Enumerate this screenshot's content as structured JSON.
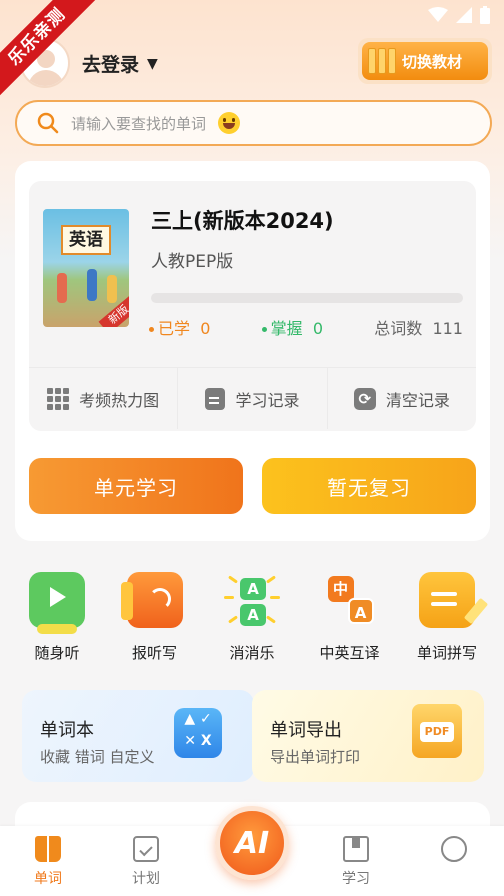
{
  "banner": {
    "ribbon_text": "乐乐亲测"
  },
  "header": {
    "login_label": "去登录",
    "switch_label": "切换教材"
  },
  "search": {
    "placeholder": "请输入要查找的单词"
  },
  "book": {
    "cover_title": "英语",
    "cover_badge": "新版",
    "title": "三上(新版本2024)",
    "publisher": "人教PEP版",
    "progress_fraction": 0,
    "learned_label": "已学",
    "learned_count": "0",
    "mastered_label": "掌握",
    "mastered_count": "0",
    "total_label": "总词数",
    "total_count": "111"
  },
  "tools": {
    "heatmap": "考频热力图",
    "record": "学习记录",
    "clear": "清空记录"
  },
  "actions": {
    "unit_study": "单元学习",
    "review": "暂无复习"
  },
  "features": [
    {
      "label": "随身听",
      "icon": "play-icon"
    },
    {
      "label": "报听写",
      "icon": "dictation-icon"
    },
    {
      "label": "消消乐",
      "icon": "match-game-icon"
    },
    {
      "label": "中英互译",
      "icon": "translate-icon"
    },
    {
      "label": "单词拼写",
      "icon": "spelling-icon"
    }
  ],
  "promos": {
    "wordbook_title": "单词本",
    "wordbook_sub": "收藏 错词 自定义",
    "export_title": "单词导出",
    "export_sub": "导出单词打印",
    "export_icon_text": "PDF"
  },
  "tabbar": {
    "words": "单词",
    "plan": "计划",
    "ai": "AI",
    "study": "学习"
  },
  "colors": {
    "accent": "#f07a1c",
    "mastered": "#35b96a",
    "review": "#f7a41a",
    "ribbon": "#d3181c"
  }
}
